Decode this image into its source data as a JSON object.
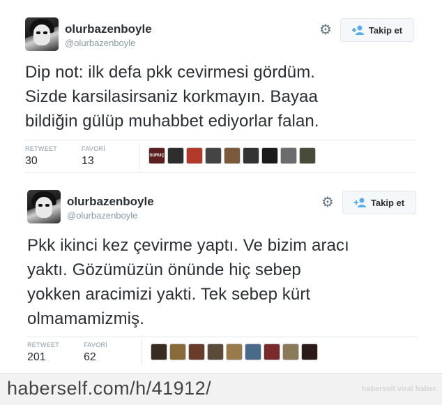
{
  "tweets": [
    {
      "display_name": "olurbazenboyle",
      "handle": "@olurbazenboyle",
      "follow_label": "Takip et",
      "text_lines": [
        "Dip not: ilk defa pkk cevirmesi gördüm.",
        "Sizde karsilasirsaniz korkmayın. Bayaa",
        "bildiğin gülüp muhabbet ediyorlar falan."
      ],
      "retweet_label": "RETWEET",
      "retweet_count": "30",
      "favorite_label": "FAVORİ",
      "favorite_count": "13",
      "favorite_avatar_badge": "SURUÇ",
      "favorite_avatar_colors": [
        "#5a2020",
        "#2d2d2d",
        "#b33a2a",
        "#444444",
        "#7a5a3a",
        "#333333",
        "#1b1b1b",
        "#6c6c6c",
        "#4a4a3a"
      ]
    },
    {
      "display_name": "olurbazenboyle",
      "handle": "@olurbazenboyle",
      "follow_label": "Takip et",
      "text_lines": [
        "Pkk ikinci kez çevirme yaptı. Ve bizim aracı",
        "yaktı. Gözümüzün önünde hiç sebep",
        "yokken aracimizi yakti. Tek sebep kürt",
        "olmamamizmiş."
      ],
      "retweet_label": "RETWEET",
      "retweet_count": "201",
      "favorite_label": "FAVORİ",
      "favorite_count": "62",
      "favorite_avatar_colors": [
        "#3a2b20",
        "#8a6a3a",
        "#6a3a2a",
        "#5a4a3a",
        "#9a7a4a",
        "#4a6a8a",
        "#7a2a2a",
        "#8a7a5a",
        "#2a1a1a"
      ]
    }
  ],
  "footer": {
    "url": "haberself.com/h/41912/",
    "watermark": "habersell.viral haber."
  },
  "icons": {
    "settings": "gear-icon",
    "follow": "add-person-icon"
  },
  "colors": {
    "text": "#292f33",
    "muted": "#8899a6",
    "follow_icon": "#55acee"
  }
}
